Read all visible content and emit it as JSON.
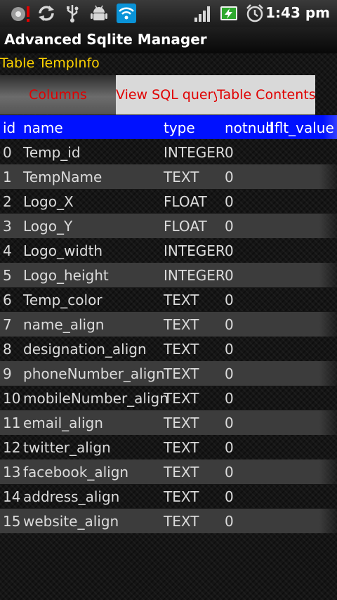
{
  "status_bar": {
    "time": "1:43 pm",
    "icons": [
      "alert-icon",
      "sync-icon",
      "usb-icon",
      "android-debug-icon",
      "wifi-icon",
      "signal-icon",
      "battery-charging-icon",
      "alarm-icon"
    ]
  },
  "app": {
    "title": "Advanced Sqlite Manager"
  },
  "table_label": "Table TempInfo",
  "tabs": [
    {
      "label": "Columns"
    },
    {
      "label": "View SQL query"
    },
    {
      "label": "Table Contents"
    }
  ],
  "columns_table": {
    "headers": [
      "id",
      "name",
      "type",
      "notnull",
      "dflt_value"
    ],
    "rows": [
      {
        "id": "0",
        "name": "Temp_id",
        "type": "INTEGER",
        "notnull": "0"
      },
      {
        "id": "1",
        "name": "TempName",
        "type": "TEXT",
        "notnull": "0"
      },
      {
        "id": "2",
        "name": "Logo_X",
        "type": "FLOAT",
        "notnull": "0"
      },
      {
        "id": "3",
        "name": "Logo_Y",
        "type": "FLOAT",
        "notnull": "0"
      },
      {
        "id": "4",
        "name": "Logo_width",
        "type": "INTEGER",
        "notnull": "0"
      },
      {
        "id": "5",
        "name": "Logo_height",
        "type": "INTEGER",
        "notnull": "0"
      },
      {
        "id": "6",
        "name": "Temp_color",
        "type": "TEXT",
        "notnull": "0"
      },
      {
        "id": "7",
        "name": "name_align",
        "type": "TEXT",
        "notnull": "0"
      },
      {
        "id": "8",
        "name": "designation_align",
        "type": "TEXT",
        "notnull": "0"
      },
      {
        "id": "9",
        "name": "phoneNumber_align",
        "type": "TEXT",
        "notnull": "0"
      },
      {
        "id": "10",
        "name": "mobileNumber_align",
        "type": "TEXT",
        "notnull": "0"
      },
      {
        "id": "11",
        "name": "email_align",
        "type": "TEXT",
        "notnull": "0"
      },
      {
        "id": "12",
        "name": "twitter_align",
        "type": "TEXT",
        "notnull": "0"
      },
      {
        "id": "13",
        "name": "facebook_align",
        "type": "TEXT",
        "notnull": "0"
      },
      {
        "id": "14",
        "name": "address_align",
        "type": "TEXT",
        "notnull": "0"
      },
      {
        "id": "15",
        "name": "website_align",
        "type": "TEXT",
        "notnull": "0"
      }
    ]
  },
  "colors": {
    "header_bg": "#0011ff",
    "table_label": "#ffd400",
    "tab_text": "#e00000"
  }
}
